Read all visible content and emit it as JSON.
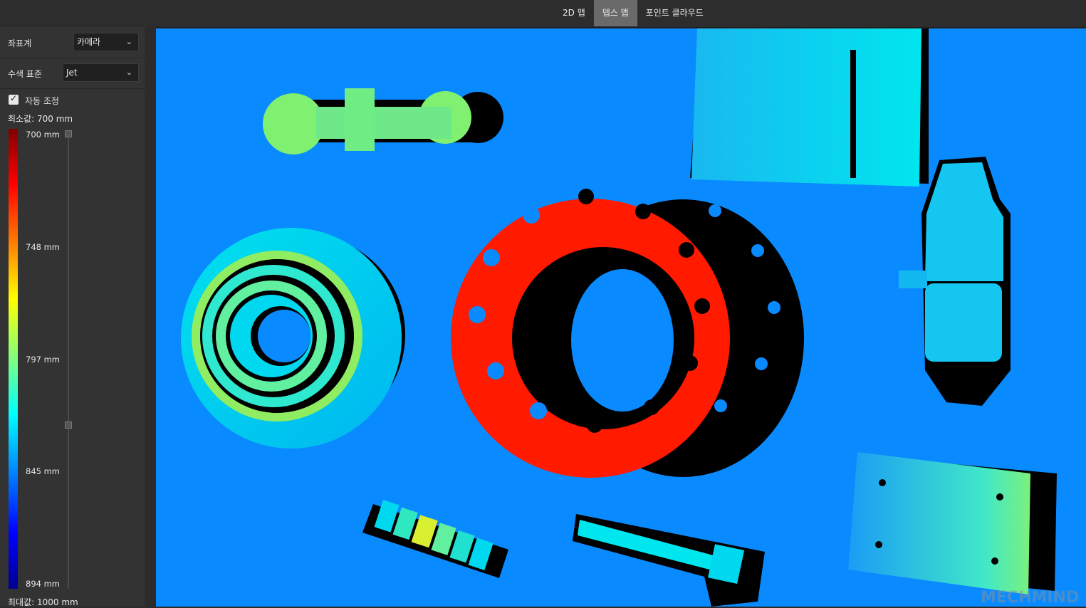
{
  "tabs": [
    {
      "label": "2D 맵",
      "active": false
    },
    {
      "label": "뎁스 맵",
      "active": true
    },
    {
      "label": "포인트 클라우드",
      "active": false
    }
  ],
  "sidebar": {
    "coord_label": "좌표계",
    "coord_value": "카메라",
    "color_label": "수색 표준",
    "color_value": "Jet",
    "auto_label": "자동 조정",
    "auto_checked": true,
    "min_text": "최소값: 700 mm",
    "max_text": "최대값: 1000 mm",
    "ticks": [
      "700 mm",
      "748 mm",
      "797 mm",
      "845 mm",
      "894 mm"
    ]
  },
  "colors": {
    "background_blue": "#0a8aff",
    "flange_red": "#ff1a00",
    "shadow": "#000000",
    "cyan": "#00e8f0",
    "green": "#7cf07c"
  },
  "watermark": "MECHMIND"
}
